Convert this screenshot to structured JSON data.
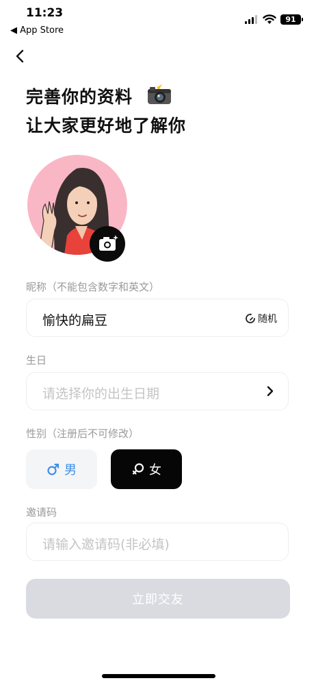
{
  "status_bar": {
    "time": "11:23",
    "back_label": "◀ App Store",
    "battery": "91"
  },
  "header": {
    "title_line1": "完善你的资料",
    "title_line2": "让大家更好地了解你"
  },
  "nickname": {
    "label": "昵称（不能包含数字和英文）",
    "value": "愉快的扁豆",
    "random_label": "随机"
  },
  "birthday": {
    "label": "生日",
    "placeholder": "请选择你的出生日期"
  },
  "gender": {
    "label": "性别（注册后不可修改）",
    "male_label": "男",
    "female_label": "女",
    "selected": "女"
  },
  "invite": {
    "label": "邀请码",
    "placeholder": "请输入邀请码(非必填)"
  },
  "submit": {
    "label": "立即交友"
  },
  "colors": {
    "accent_male": "#3d8fe6",
    "selected_bg": "#060606",
    "submit_disabled": "#d9dbe0",
    "avatar_bg": "#f9b7c6"
  }
}
